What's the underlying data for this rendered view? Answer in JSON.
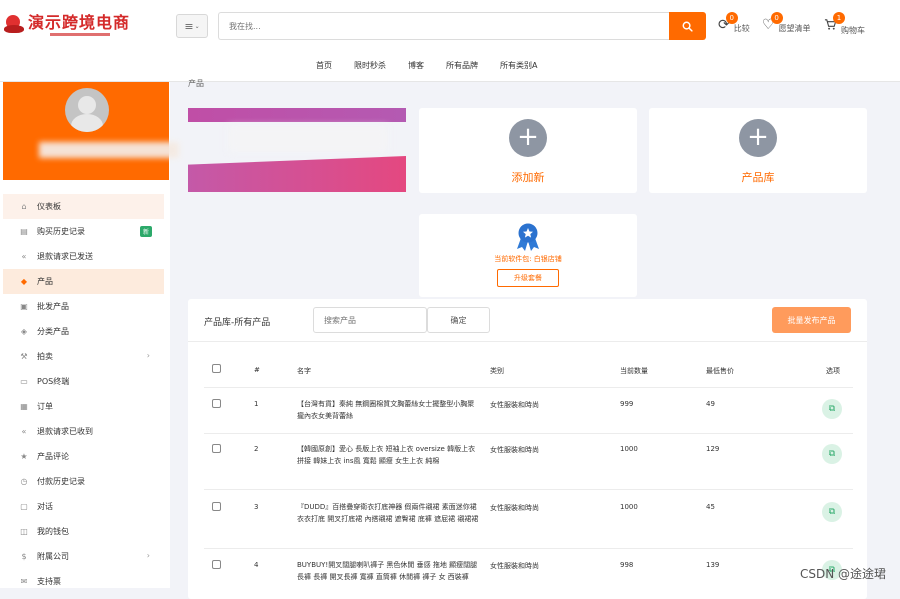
{
  "header": {
    "logo_text": "演示跨境电商",
    "menu_icon": "hamburger-icon",
    "search_placeholder": "我在找...",
    "tools": [
      {
        "icon": "refresh-icon",
        "count": "0",
        "label": "比较"
      },
      {
        "icon": "heart-icon",
        "count": "0",
        "label": "愿望清单"
      },
      {
        "icon": "cart-icon",
        "count": "1",
        "label": "购物车"
      }
    ],
    "nav": [
      "首页",
      "限时秒杀",
      "博客",
      "所有品牌",
      "所有类别A"
    ]
  },
  "sidebar": {
    "items": [
      {
        "label": "仪表板",
        "icon": "home-icon",
        "active": true
      },
      {
        "label": "购买历史记录",
        "icon": "doc-icon",
        "badge": "新"
      },
      {
        "label": "退款请求已发送",
        "icon": "rewind-icon"
      },
      {
        "label": "产品",
        "icon": "diamond-icon",
        "active": true
      },
      {
        "label": "批发产品",
        "icon": "box-icon"
      },
      {
        "label": "分类产品",
        "icon": "tag-icon"
      },
      {
        "label": "拍卖",
        "icon": "gavel-icon",
        "arrow": true
      },
      {
        "label": "POS终端",
        "icon": "pos-icon"
      },
      {
        "label": "订单",
        "icon": "order-icon"
      },
      {
        "label": "退款请求已收到",
        "icon": "rewind-icon"
      },
      {
        "label": "产品评论",
        "icon": "star-icon"
      },
      {
        "label": "付款历史记录",
        "icon": "history-icon"
      },
      {
        "label": "对话",
        "icon": "chat-icon"
      },
      {
        "label": "我的钱包",
        "icon": "wallet-icon"
      },
      {
        "label": "附属公司",
        "icon": "dollar-icon",
        "arrow": true
      },
      {
        "label": "支持票",
        "icon": "ticket-icon"
      }
    ]
  },
  "main": {
    "breadcrumb": "产品",
    "cards": {
      "add_new": "添加新",
      "library": "产品库"
    },
    "package": {
      "text": "当前软件包: 白银店铺",
      "button": "升级套餐"
    },
    "table": {
      "title": "产品库-所有产品",
      "search_placeholder": "搜索产品",
      "confirm": "确定",
      "bulk_button": "批量发布产品",
      "columns": [
        "#",
        "名字",
        "类别",
        "当前数量",
        "最低售价",
        "选项"
      ],
      "rows": [
        {
          "num": "1",
          "name": "【台灣有貨】秦純 無鋼圈棉質文胸蕾絲女士擺整型小胸聚攏內衣女美背蕾絲",
          "category": "女性服裝和時尚",
          "qty": "999",
          "price": "49"
        },
        {
          "num": "2",
          "name": "【韓國原創】愛心 長版上衣 短袖上衣 oversize 韓版上衣 拼接 韓妹上衣 ins風 寬鬆 顯瘦 女生上衣 純棉",
          "category": "女性服裝和時尚",
          "qty": "1000",
          "price": "129"
        },
        {
          "num": "3",
          "name": "『DUDD』百搭疊穿衛衣打底神器 假兩件襯裙 素面迷你裙 衣衣打底 開叉打底裙 內搭襯裙 遮臀裙 底褲 遮屁裙 襯裙裙",
          "category": "女性服裝和時尚",
          "qty": "1000",
          "price": "45"
        },
        {
          "num": "4",
          "name": "BUYBUY!開叉闊腿喇叭褲子 黑色休閒 垂感 拖地 顯瘦闊腿長褲 長褲 開叉長褲 寬褲 直筒褲 休閒褲 褲子 女 西裝褲",
          "category": "女性服裝和時尚",
          "qty": "998",
          "price": "139"
        }
      ]
    }
  },
  "watermark": "CSDN @途途珺",
  "colors": {
    "accent": "#ff6a00",
    "badge_green": "#2ca96a"
  }
}
